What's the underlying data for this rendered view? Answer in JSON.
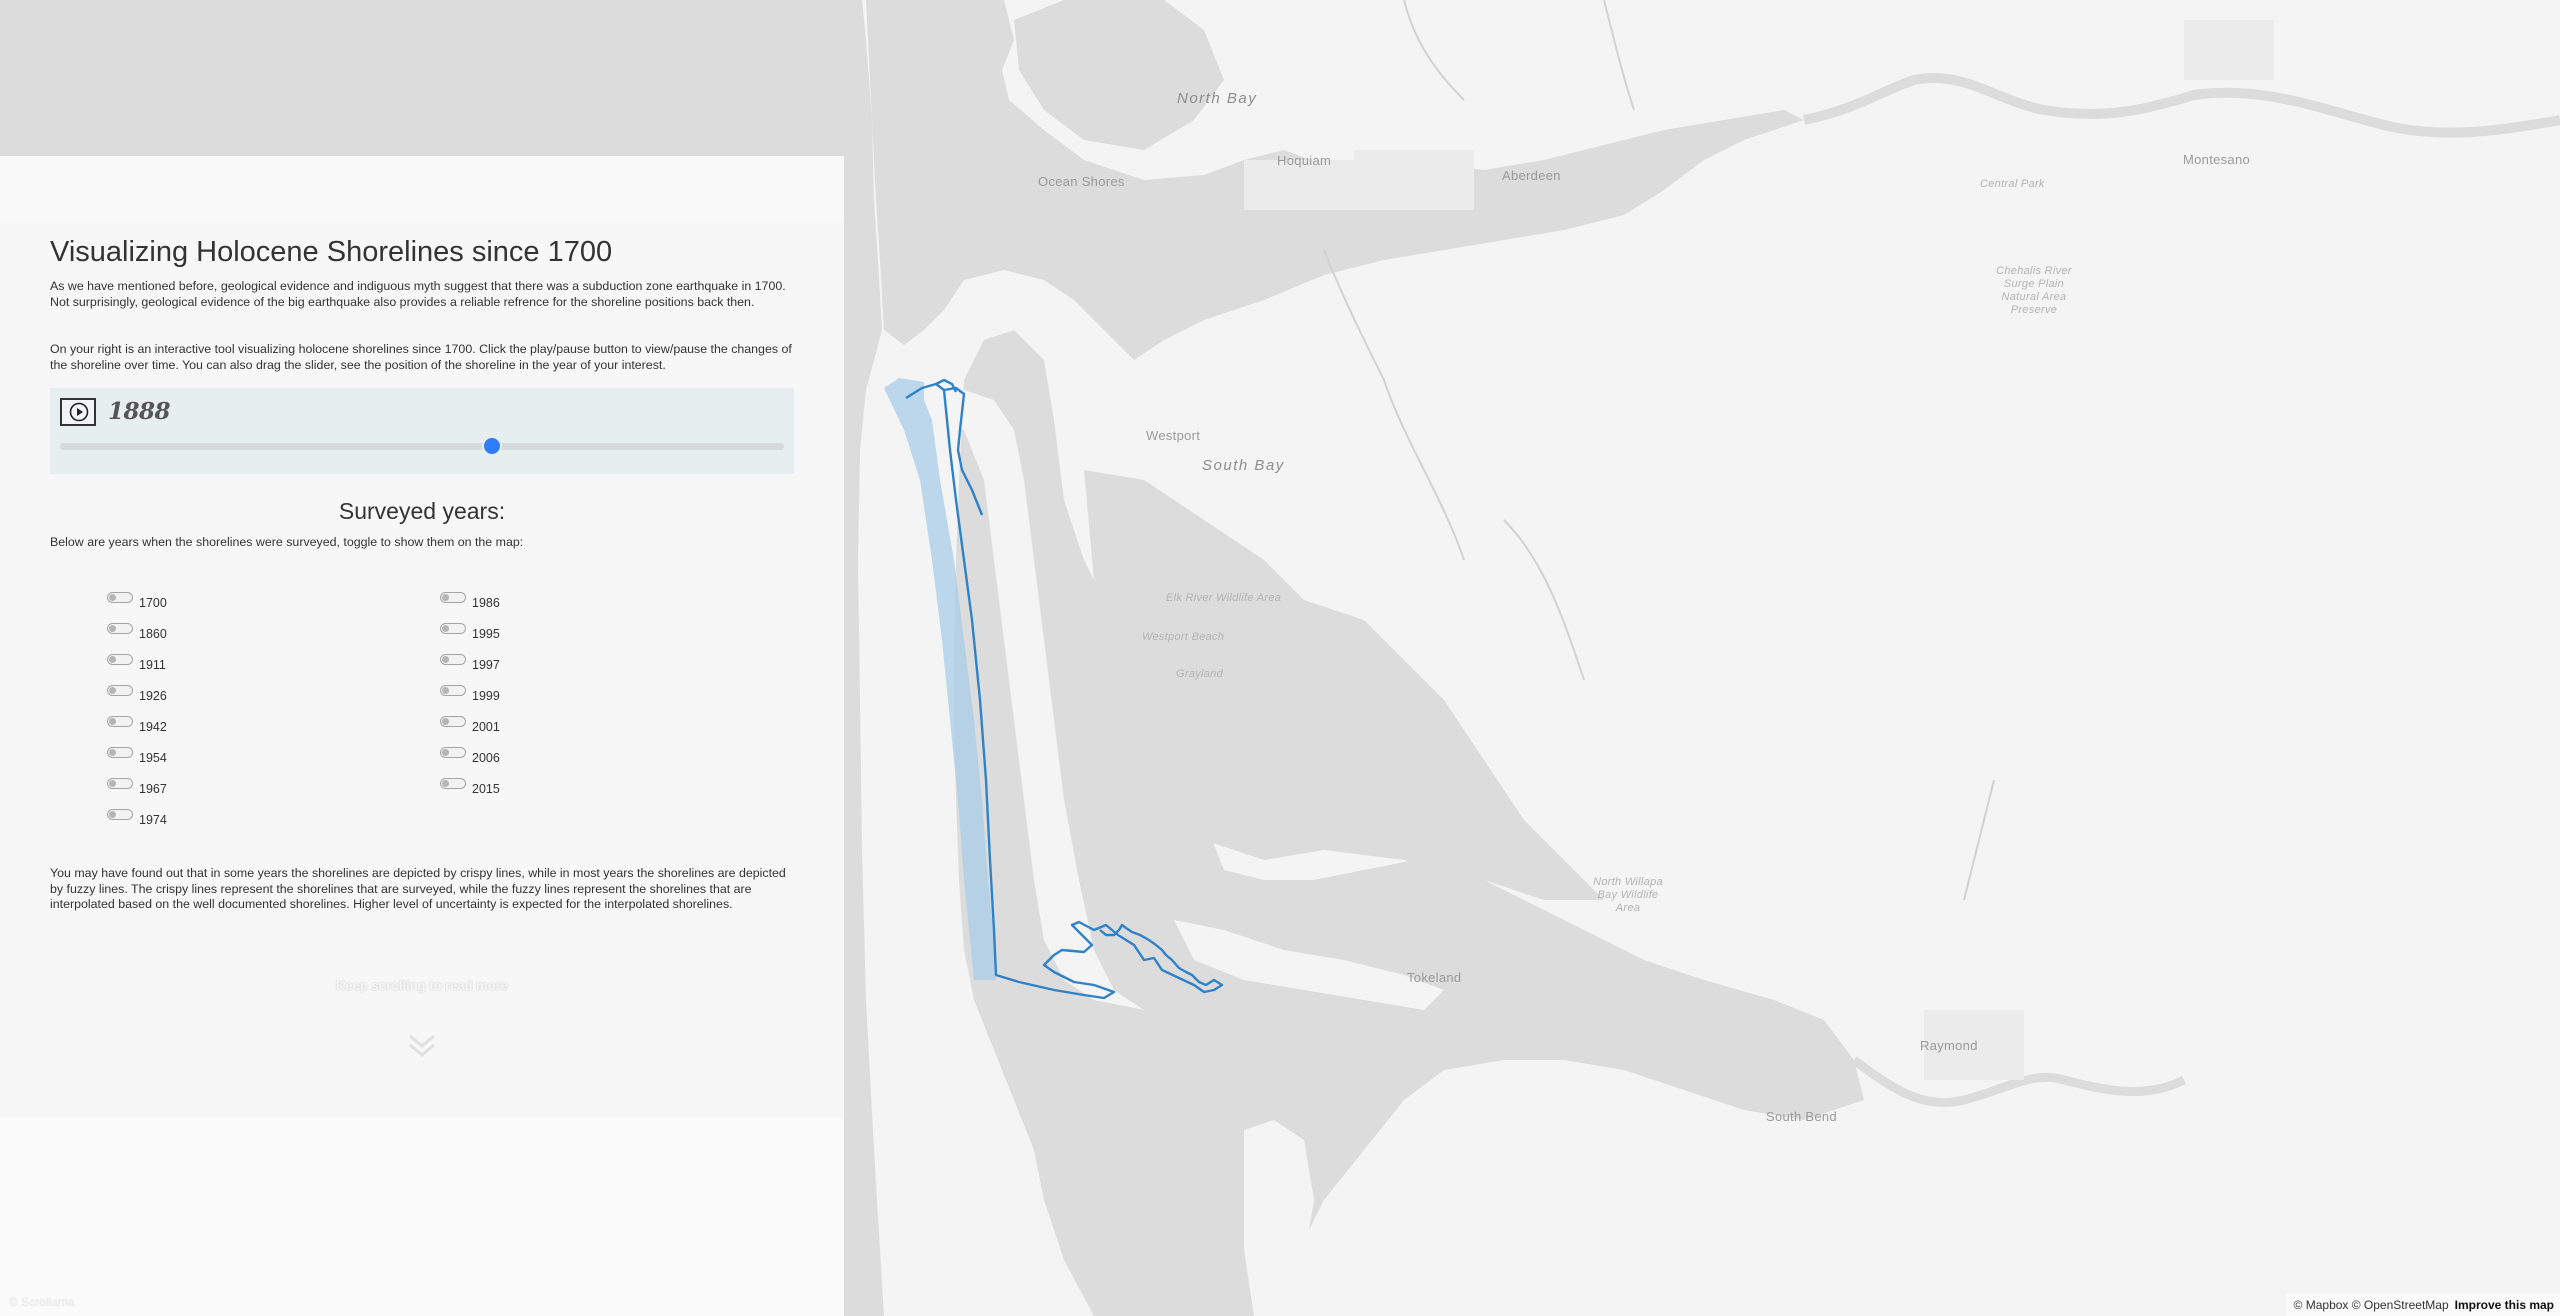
{
  "story": {
    "title": "Visualizing Holocene Shorelines since 1700",
    "paragraph_1": "As we have mentioned before, geological evidence and indiguous myth suggest that there was a subduction zone earthquake in 1700. Not surprisingly, geological evidence of the big earthquake also provides a reliable refrence for the shoreline positions back then.",
    "paragraph_2": "On your right is an interactive tool visualizing holocene shorelines since 1700. Click the play/pause button to view/pause the changes of the shoreline over time. You can also drag the slider, see the position of the shoreline in the year of your interest.",
    "paragraph_3": "You may have found out that in some years the shorelines are depicted by crispy lines, while in most years the shorelines are depicted by fuzzy lines. The crispy lines represent the shorelines that are surveyed, while the fuzzy lines represent the shorelines that are interpolated based on the well documented shorelines. Higher level of uncertainty is expected for the interpolated shorelines.",
    "keep_scrolling": "Keep scrolling to read more",
    "corner_text": "© Scrollama"
  },
  "player": {
    "current_year": "1888",
    "play_icon": "play-icon",
    "year_min": 1700,
    "year_max": 2015,
    "slider_value": 1888,
    "accent_color": "#2f7cf6"
  },
  "surveyed": {
    "title": "Surveyed years:",
    "description": "Below are years when the shorelines were surveyed, toggle to show them on the map:",
    "years_col1": [
      "1700",
      "1860",
      "1911",
      "1926",
      "1942",
      "1954",
      "1967",
      "1974"
    ],
    "years_col2": [
      "1986",
      "1995",
      "1997",
      "1999",
      "2001",
      "2006",
      "2015"
    ]
  },
  "map": {
    "labels": {
      "north_bay": "North Bay",
      "south_bay": "South Bay",
      "ocean_shores": "Ocean Shores",
      "hoquiam": "Hoquiam",
      "aberdeen": "Aberdeen",
      "montesano": "Montesano",
      "central_park": "Central Park",
      "chehalis": "Chehalis River Surge Plain Natural Area Preserve",
      "westport": "Westport",
      "wildlife_area": "Elk River Wildlife Area",
      "westport_beach": "Westport Beach",
      "grayland": "Grayland",
      "north_willapa": "North Willapa Bay Wildlife Area",
      "tokeland": "Tokeland",
      "raymond": "Raymond",
      "south_bend": "South Bend"
    },
    "shoreline_color": "#2f82c8",
    "uncertainty_color": "#a9cde8",
    "attribution": "© Mapbox © OpenStreetMap",
    "improve_link": "Improve this map"
  }
}
